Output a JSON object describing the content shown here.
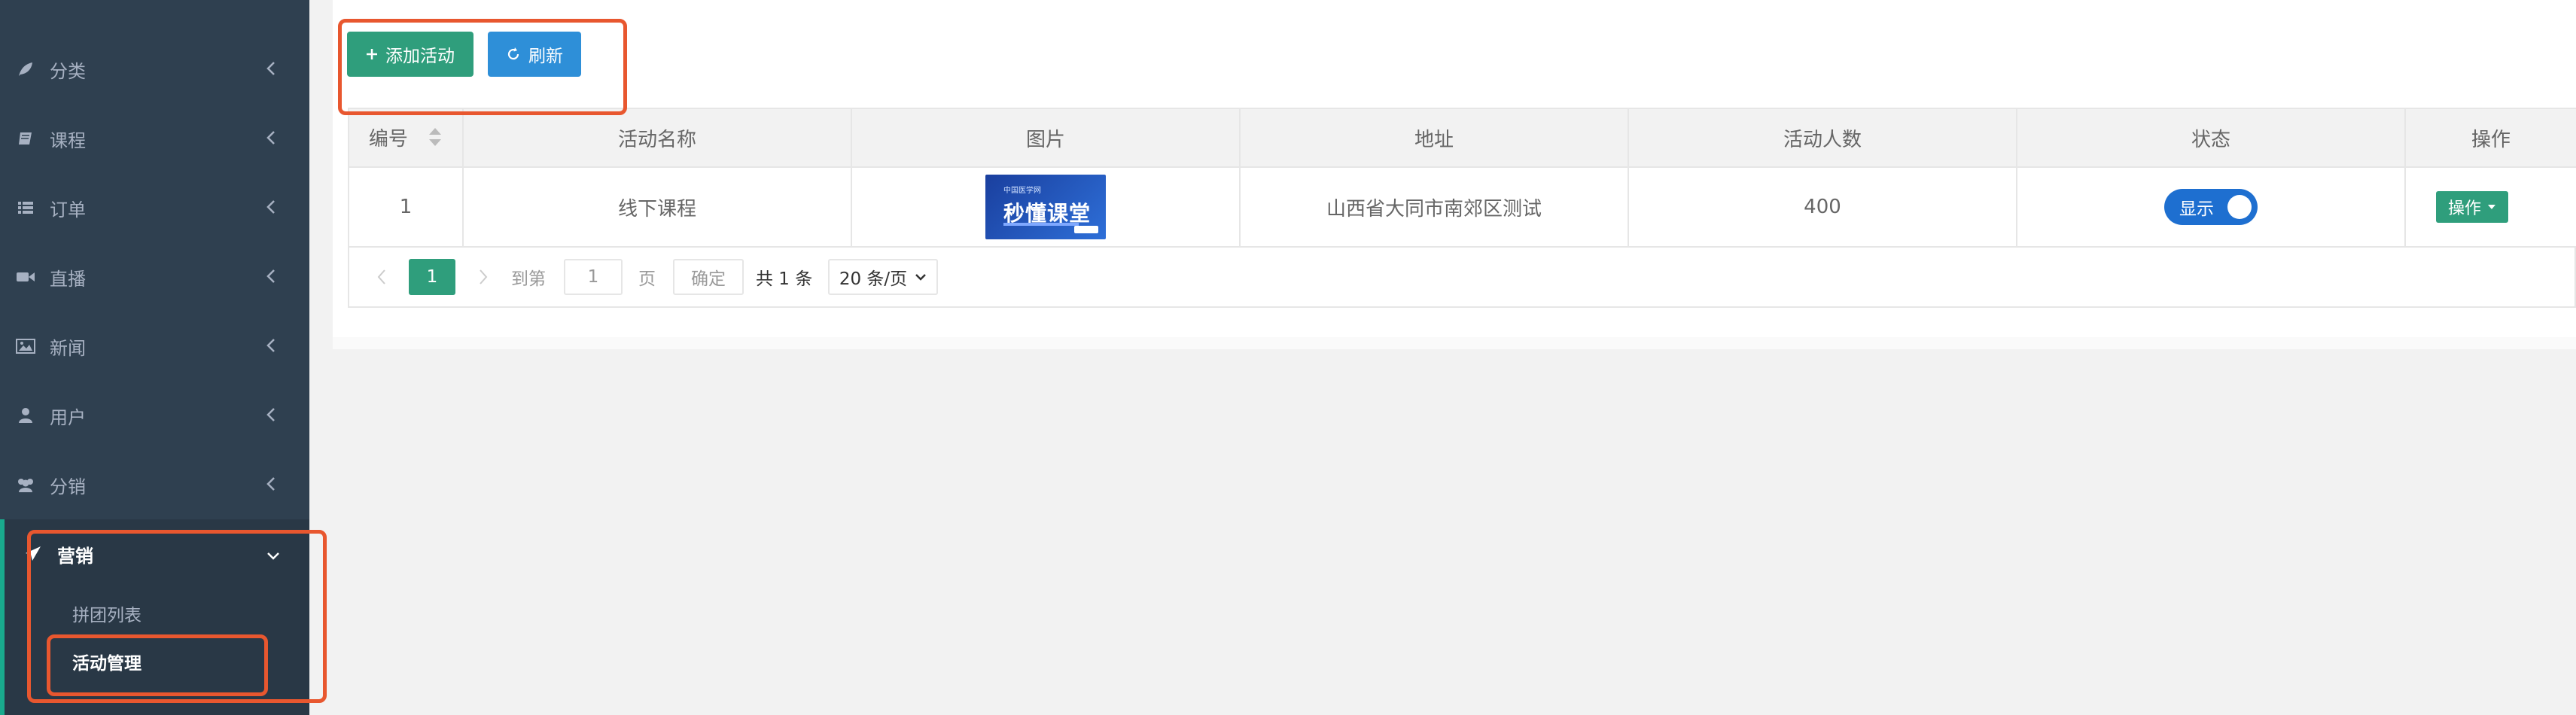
{
  "sidebar": {
    "items": [
      {
        "label": "分类",
        "icon": "leaf-icon"
      },
      {
        "label": "课程",
        "icon": "book-icon"
      },
      {
        "label": "订单",
        "icon": "list-icon"
      },
      {
        "label": "直播",
        "icon": "video-camera-icon"
      },
      {
        "label": "新闻",
        "icon": "picture-icon"
      },
      {
        "label": "用户",
        "icon": "user-icon"
      },
      {
        "label": "分销",
        "icon": "users-icon"
      }
    ],
    "open_menu": {
      "label": "营销",
      "icon": "paper-plane-icon",
      "children": [
        {
          "label": "拼团列表"
        },
        {
          "label": "活动管理",
          "active": true
        }
      ]
    }
  },
  "toolbar": {
    "add_label": "添加活动",
    "refresh_label": "刷新"
  },
  "table": {
    "headers": [
      "编号",
      "活动名称",
      "图片",
      "地址",
      "活动人数",
      "状态",
      "操作"
    ],
    "rows": [
      {
        "id": "1",
        "name": "线下课程",
        "image": {
          "title": "秒懂课堂",
          "subtitle": "中国医学网"
        },
        "address": "山西省大同市南郊区测试",
        "count": "400",
        "status": "显示",
        "action": "操作"
      }
    ]
  },
  "pagination": {
    "current": "1",
    "goto_label": "到第",
    "page_input": "1",
    "page_unit": "页",
    "confirm": "确定",
    "total": "共 1 条",
    "page_size": "20 条/页"
  },
  "colors": {
    "sidebar_bg": "#2f4050",
    "accent_green": "#2f9e7c",
    "accent_blue": "#2e8fd8",
    "annotation_red": "#e8572f"
  }
}
